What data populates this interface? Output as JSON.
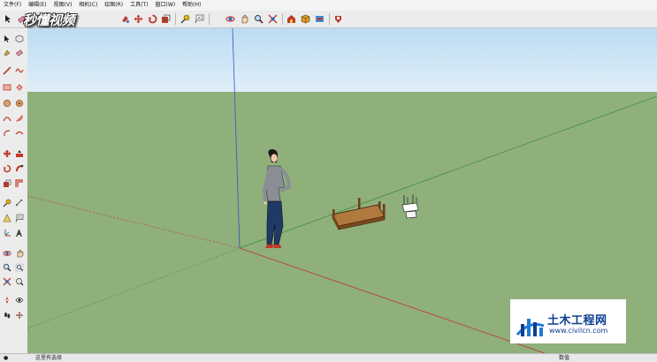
{
  "menu": [
    "文件(F)",
    "编辑(E)",
    "视图(V)",
    "相机(C)",
    "绘图(R)",
    "工具(T)",
    "窗口(W)",
    "帮助(H)"
  ],
  "watermark": "秒懂视频",
  "status": {
    "hint": "这里有选择",
    "measure": "数值"
  },
  "logo": {
    "title": "土木工程网",
    "url": "www.civilcn.com"
  },
  "colors": {
    "sky": "#e0eef8",
    "ground": "#8faf7b",
    "axis_red": "#c0392b",
    "axis_green": "#3f8f3f",
    "axis_blue": "#3057c4",
    "logo_blue": "#0b3f8f"
  },
  "icons": {
    "toolbar": [
      "select-icon",
      "eraser-icon",
      "paint-icon",
      "move-icon",
      "rotate-icon",
      "scale-icon",
      "tape-icon",
      "text-icon",
      "orbit-icon",
      "pan-icon",
      "zoom-icon",
      "zoom-extents-icon",
      "warehouse-icon",
      "component-icon",
      "extension-icon"
    ],
    "left": [
      "select-icon",
      "component-icon",
      "paint-icon",
      "eraser-icon",
      "line-icon",
      "freehand-icon",
      "rectangle-icon",
      "rotated-rect-icon",
      "circle-icon",
      "polygon-icon",
      "arc-icon",
      "pie-icon",
      "arc3-icon",
      "arc2-icon",
      "move-icon",
      "pushpull-icon",
      "rotate-icon",
      "followme-icon",
      "scale-icon",
      "offset-icon",
      "tape-icon",
      "dimension-icon",
      "protractor-icon",
      "text-icon",
      "axes-icon",
      "3dtext-icon",
      "orbit-icon",
      "pan-icon",
      "zoom-icon",
      "zoom-window-icon",
      "zoom-extents-icon",
      "prev-view-icon",
      "position-camera-icon",
      "look-around-icon",
      "walk-icon",
      "section-icon"
    ]
  }
}
